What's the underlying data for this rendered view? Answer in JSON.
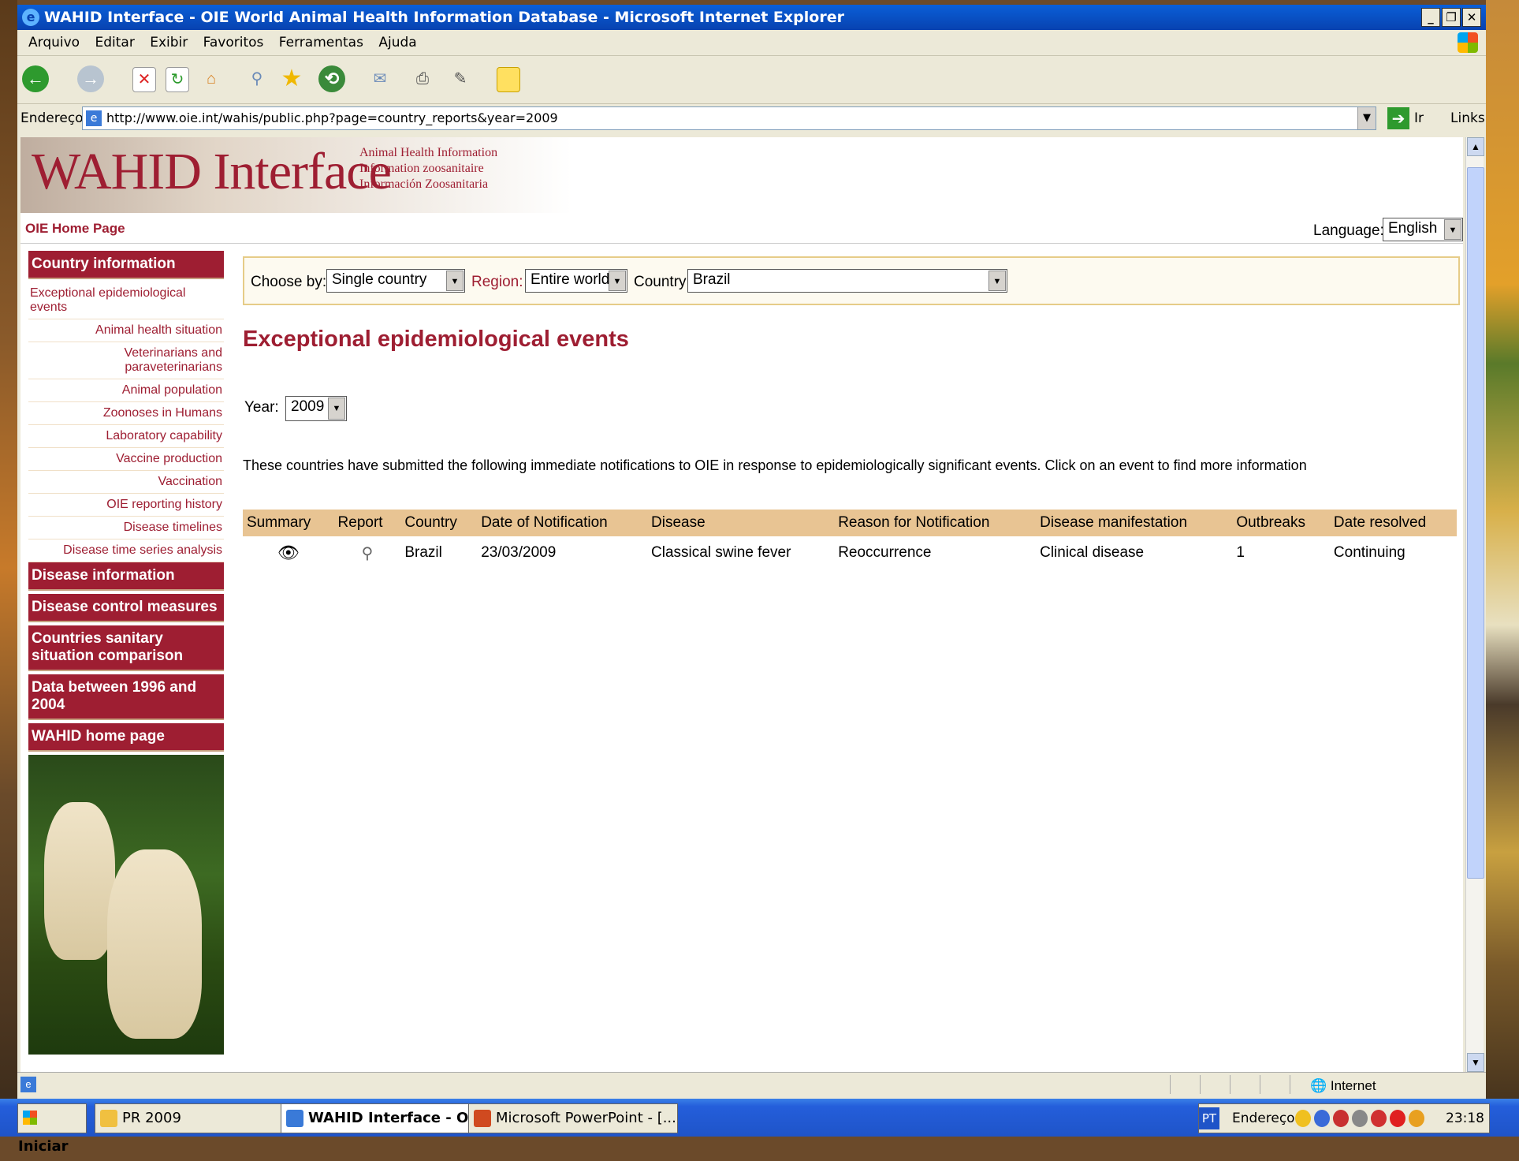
{
  "window": {
    "title": "WAHID Interface - OIE World Animal Health Information Database - Microsoft Internet Explorer"
  },
  "menubar": {
    "items": [
      "Arquivo",
      "Editar",
      "Exibir",
      "Favoritos",
      "Ferramentas",
      "Ajuda"
    ]
  },
  "addressbar": {
    "label": "Endereço",
    "url": "http://www.oie.int/wahis/public.php?page=country_reports&year=2009",
    "go_label": "Ir",
    "links_label": "Links"
  },
  "banner": {
    "logo": "WAHID Interface",
    "tagline": [
      "Animal Health Information",
      "Information zoosanitaire",
      "Información Zoosanitaria"
    ]
  },
  "topnav": {
    "home": "OIE Home Page",
    "language_label": "Language:",
    "language_value": "English"
  },
  "sidebar": {
    "country_info": "Country information",
    "items": [
      "Exceptional epidemiological events",
      "Animal health situation",
      "Veterinarians and paraveterinarians",
      "Animal population",
      "Zoonoses in Humans",
      "Laboratory capability",
      "Vaccine production",
      "Vaccination",
      "OIE reporting history",
      "Disease timelines",
      "Disease time series analysis"
    ],
    "sections": [
      "Disease information",
      "Disease control measures",
      "Countries sanitary situation comparison",
      "Data between 1996 and 2004",
      "WAHID home page"
    ]
  },
  "filter": {
    "choose_label": "Choose by:",
    "choose_value": "Single country",
    "region_label": "Region:",
    "region_value": "Entire world",
    "country_label": "Country:",
    "country_value": "Brazil"
  },
  "main": {
    "title": "Exceptional epidemiological events",
    "year_label": "Year:",
    "year_value": "2009",
    "intro": "These countries have submitted the following immediate notifications to OIE in response to epidemiologically significant events. Click on an event to find more information"
  },
  "table": {
    "headers": [
      "Summary",
      "Report",
      "Country",
      "Date of Notification",
      "Disease",
      "Reason for Notification",
      "Disease manifestation",
      "Outbreaks",
      "Date resolved"
    ],
    "rows": [
      {
        "country": "Brazil",
        "date": "23/03/2009",
        "disease": "Classical swine fever",
        "reason": "Reoccurrence",
        "manifestation": "Clinical disease",
        "outbreaks": "1",
        "resolved": "Continuing"
      }
    ]
  },
  "statusbar": {
    "zone": "Internet"
  },
  "taskbar": {
    "start": "Iniciar",
    "tasks": [
      "PR 2009",
      "WAHID Interface - OI...",
      "Microsoft PowerPoint - [..."
    ],
    "lang": "PT",
    "address_label": "Endereço",
    "clock": "23:18"
  }
}
